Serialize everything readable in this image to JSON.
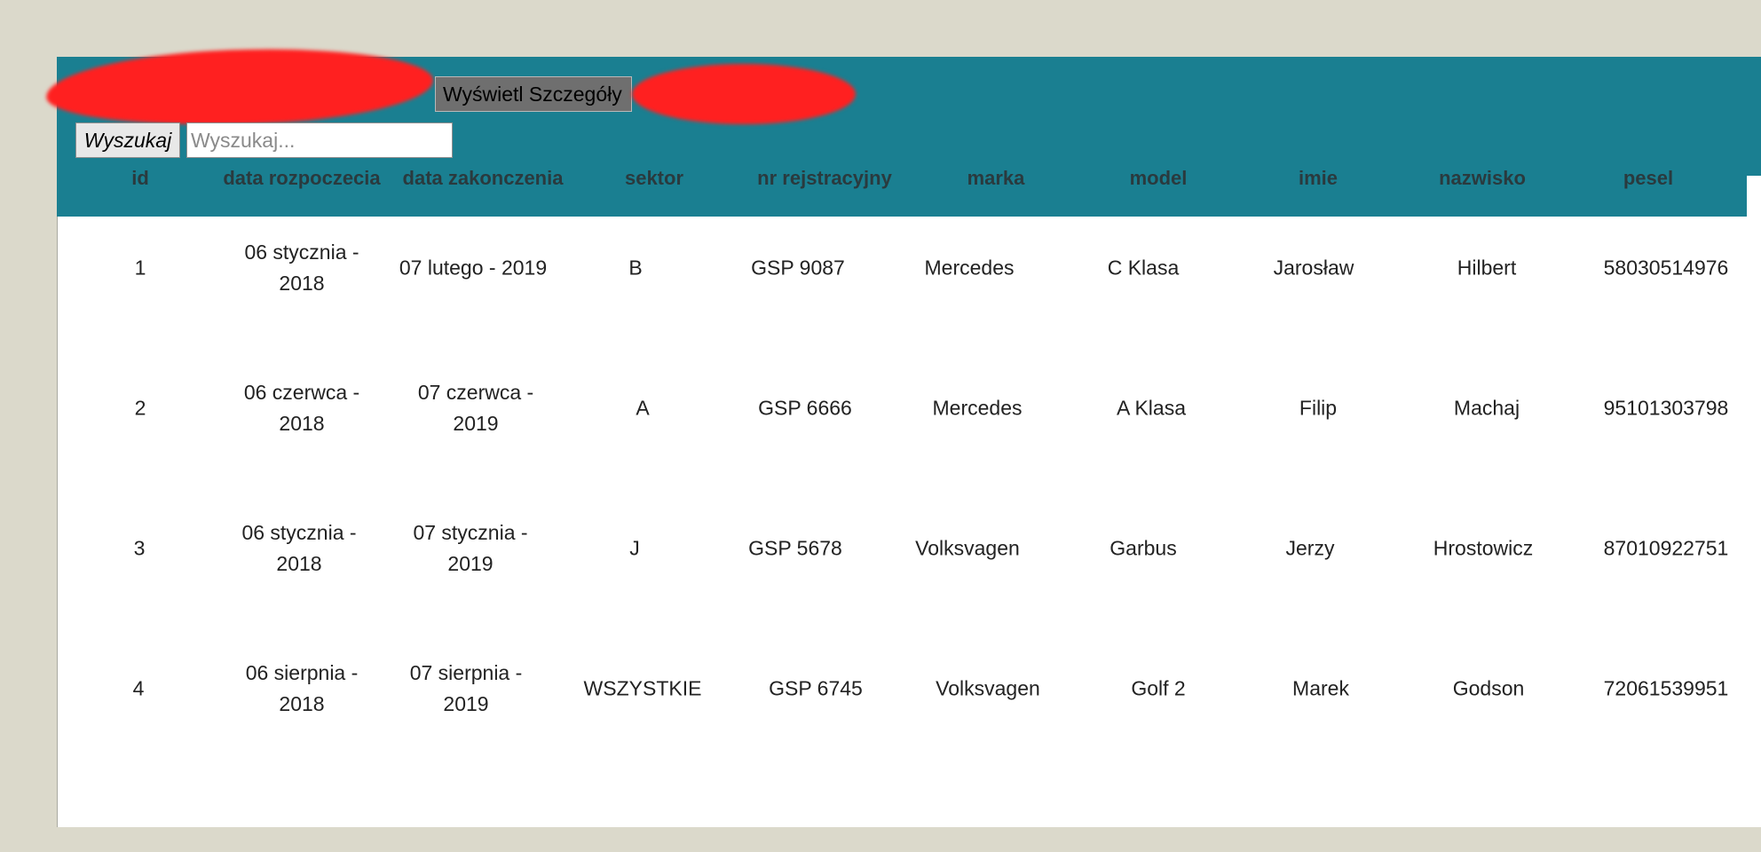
{
  "toolbar": {
    "details_label": "Wyświetl Szczegóły",
    "search_label": "Wyszukaj",
    "search_placeholder": "Wyszukaj...",
    "search_value": ""
  },
  "table": {
    "headers": [
      "id",
      "data rozpoczecia",
      "data zakonczenia",
      "sektor",
      "nr rejstracyjny",
      "marka",
      "model",
      "imie",
      "nazwisko",
      "pesel"
    ],
    "rows": [
      [
        "1",
        "06 stycznia - 2018",
        "07 lutego - 2019",
        "B",
        "GSP 9087",
        "Mercedes",
        "C Klasa",
        "Jarosław",
        "Hilbert",
        "58030514976"
      ],
      [
        "2",
        "06 czerwca - 2018",
        "07 czerwca - 2019",
        "A",
        "GSP 6666",
        "Mercedes",
        "A Klasa",
        "Filip",
        "Machaj",
        "95101303798"
      ],
      [
        "3",
        "06 stycznia - 2018",
        "07 stycznia - 2019",
        "J",
        "GSP 5678",
        "Volksvagen",
        "Garbus",
        "Jerzy",
        "Hrostowicz",
        "87010922751"
      ],
      [
        "4",
        "06 sierpnia - 2018",
        "07 sierpnia - 2019",
        "WSZYSTKIE",
        "GSP 6745",
        "Volksvagen",
        "Golf 2",
        "Marek",
        "Godson",
        "72061539951"
      ]
    ]
  },
  "colors": {
    "header_bg": "#1a7f91",
    "page_bg": "#dbd9cb",
    "redaction": "#ff2020"
  }
}
